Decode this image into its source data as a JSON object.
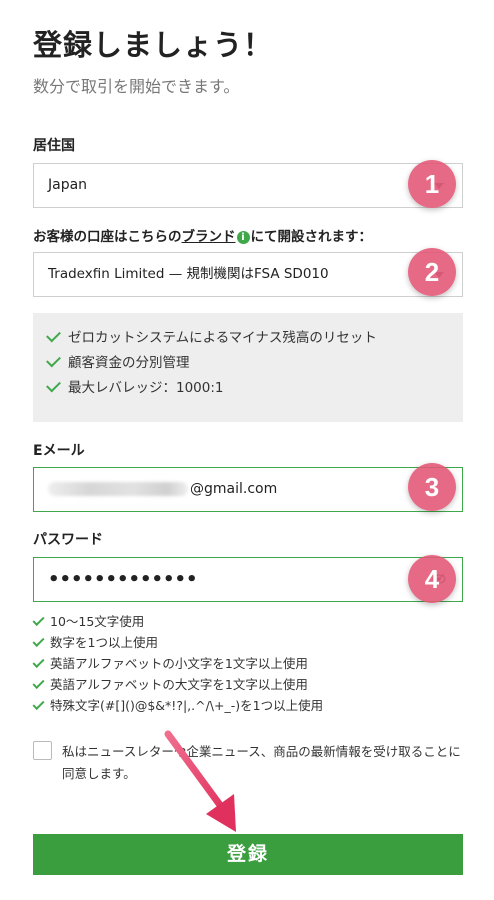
{
  "header": {
    "title": "登録しましょう！",
    "subtitle": "数分で取引を開始できます。"
  },
  "residence": {
    "label": "居住国",
    "value": "Japan"
  },
  "account": {
    "label_prefix": "お客様の口座はこちらの",
    "label_link": "ブランド",
    "info_icon": "i",
    "label_suffix": "にて開設されます：",
    "value": "Tradexfin Limited — 規制機関はFSA SD010"
  },
  "features": [
    "ゼロカットシステムによるマイナス残高のリセット",
    "顧客資金の分別管理",
    "最大レバレッジ：1000:1"
  ],
  "email": {
    "label": "Eメール",
    "value_suffix": "@gmail.com"
  },
  "password": {
    "label": "パスワード",
    "value": "•••••••••••••",
    "rules": [
      "10～15文字使用",
      "数字を1つ以上使用",
      "英語アルファベットの小文字を1文字以上使用",
      "英語アルファベットの大文字を1文字以上使用",
      "特殊文字(#[]()@$&*!?|,.^/\\+_-)を1つ以上使用"
    ]
  },
  "consent": {
    "text": "私はニュースレターや企業ニュース、商品の最新情報を受け取ることに同意します。",
    "checked": false
  },
  "submit": {
    "label": "登録"
  },
  "badges": [
    "1",
    "2",
    "3",
    "4"
  ],
  "colors": {
    "accent": "#3a9e3e",
    "badge": "#e25574",
    "feature_bg": "#eeeeee"
  }
}
